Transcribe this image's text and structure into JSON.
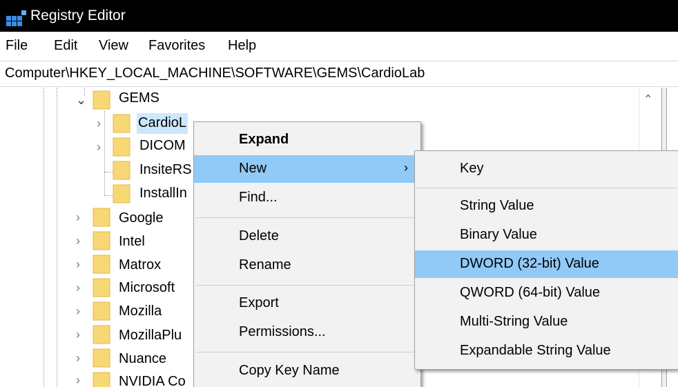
{
  "window": {
    "title": "Registry Editor",
    "icon": "registry-editor-icon"
  },
  "menubar": {
    "items": [
      "File",
      "Edit",
      "View",
      "Favorites",
      "Help"
    ]
  },
  "address": {
    "path": "Computer\\HKEY_LOCAL_MACHINE\\SOFTWARE\\GEMS\\CardioLab"
  },
  "tree": {
    "gems": "GEMS",
    "children": [
      "CardioL",
      "DICOM",
      "InsiteRS",
      "InstallIn"
    ],
    "siblings": [
      "Google",
      "Intel",
      "Matrox",
      "Microsoft",
      "Mozilla",
      "MozillaPlu",
      "Nuance",
      "NVIDIA Co"
    ]
  },
  "context_menu": {
    "expand": "Expand",
    "new": "New",
    "find": "Find...",
    "delete": "Delete",
    "rename": "Rename",
    "export": "Export",
    "permissions": "Permissions...",
    "copy_key_name": "Copy Key Name"
  },
  "new_submenu": {
    "key": "Key",
    "string_value": "String Value",
    "binary_value": "Binary Value",
    "dword_value": "DWORD (32-bit) Value",
    "qword_value": "QWORD (64-bit) Value",
    "multi_string_value": "Multi-String Value",
    "expandable_string_value": "Expandable String Value"
  },
  "colors": {
    "titlebar": "#000000",
    "highlight": "#91c9f7",
    "folder": "#f8d775",
    "selection": "#cce8ff"
  }
}
